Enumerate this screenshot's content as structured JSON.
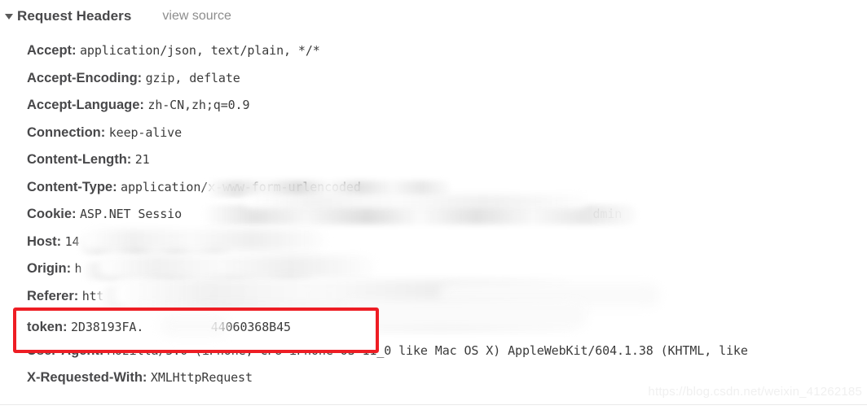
{
  "panel": {
    "section_title": "Request Headers",
    "view_source_label": "view source",
    "disclosure_state": "expanded"
  },
  "headers": [
    {
      "name": "Accept:",
      "value": "application/json, text/plain, */*"
    },
    {
      "name": "Accept-Encoding:",
      "value": "gzip, deflate"
    },
    {
      "name": "Accept-Language:",
      "value": "zh-CN,zh;q=0.9"
    },
    {
      "name": "Connection:",
      "value": "keep-alive"
    },
    {
      "name": "Content-Length:",
      "value": "21"
    },
    {
      "name": "Content-Type:",
      "value": "application/x-www-form-urlencoded"
    },
    {
      "name": "Cookie:",
      "value": "ASP.NET Sessio"
    },
    {
      "name": "Host:",
      "value": "14"
    },
    {
      "name": "Origin:",
      "value": "h"
    },
    {
      "name": "Referer:",
      "value": "htt"
    },
    {
      "name": "token:",
      "value": "2D38193FA."
    },
    {
      "name": "User-Agent:",
      "value": "Mozilla/5.0 (iPhone; CPU iPhone OS 11_0 like Mac OS X) AppleWebKit/604.1.38 (KHTML, like"
    },
    {
      "name": "X-Requested-With:",
      "value": "XMLHttpRequest"
    }
  ],
  "partial_values": {
    "cookie_tail": "dmin",
    "token_tail": "44060368B45"
  },
  "annotation": {
    "type": "rectangle-highlight",
    "color": "#ee1d24",
    "target_header": "token"
  },
  "watermark": {
    "text": "https://blog.csdn.net/weixin_41262185"
  }
}
